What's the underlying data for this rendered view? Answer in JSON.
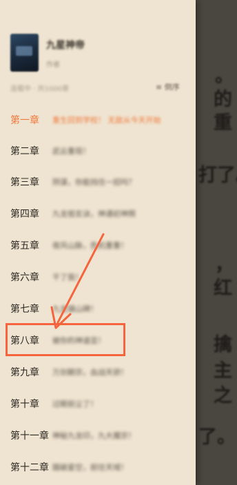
{
  "reader_background": {
    "visible_fragments": [
      "。",
      "的",
      "重",
      "打了。",
      "，",
      "红",
      "擒",
      "主",
      "之",
      "了。"
    ]
  },
  "book": {
    "title": "九星神帝",
    "author": "作者",
    "meta": "连载中 · 共1000章",
    "sort_label": "≡ 倒序",
    "cover_icon": "book-cover-image"
  },
  "chapters": [
    {
      "number": "第一章",
      "title": "重生回到学校！  无敌从今天开始",
      "active": true
    },
    {
      "number": "第二章",
      "title": "武云重现！"
    },
    {
      "number": "第三章",
      "title": "阴谋，你能挡住一招吗？"
    },
    {
      "number": "第四章",
      "title": "九龙祖玄诀，神通初神照"
    },
    {
      "number": "第五章",
      "title": "夜风山脉，危机重重！"
    },
    {
      "number": "第六章",
      "title": "干了我！"
    },
    {
      "number": "第七章",
      "title": "九龙镇山碑！"
    },
    {
      "number": "第八章",
      "title": "被你的神道显！"
    },
    {
      "number": "第九章",
      "title": "万剑朝宗，血战天骄！"
    },
    {
      "number": "第十章",
      "title": "过眼前尘了！"
    },
    {
      "number": "第十一章",
      "title": "神秘九龙印，九大魔宗！"
    },
    {
      "number": "第十二章",
      "title": "踏破星空，前往天域！"
    }
  ],
  "annotation": {
    "color": "#f5643c",
    "highlighted_chapter": "第八章"
  },
  "colors": {
    "accent": "#f07a3c",
    "drawer_bg": "#efe4d1"
  }
}
